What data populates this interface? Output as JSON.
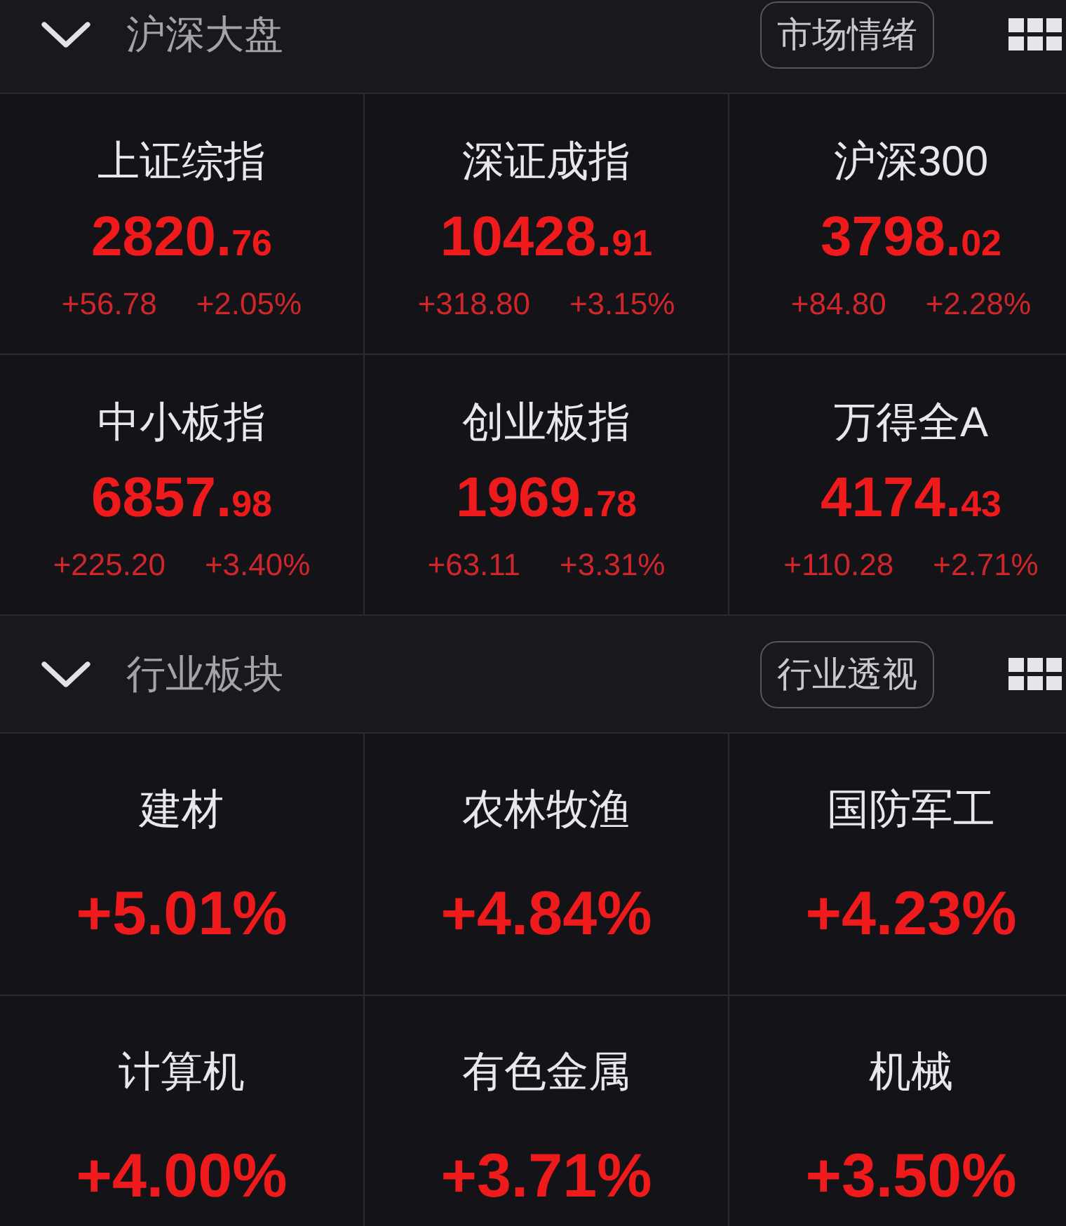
{
  "sections": [
    {
      "kind": "index",
      "title": "沪深大盘",
      "expanded": true,
      "button": "市场情绪",
      "items": [
        {
          "name": "上证综指",
          "value": "2820.76",
          "change": "+56.78",
          "change_pct": "+2.05%",
          "rising": true
        },
        {
          "name": "深证成指",
          "value": "10428.91",
          "change": "+318.80",
          "change_pct": "+3.15%",
          "rising": true
        },
        {
          "name": "沪深300",
          "value": "3798.02",
          "change": "+84.80",
          "change_pct": "+2.28%",
          "rising": true
        },
        {
          "name": "中小板指",
          "value": "6857.98",
          "change": "+225.20",
          "change_pct": "+3.40%",
          "rising": true
        },
        {
          "name": "创业板指",
          "value": "1969.78",
          "change": "+63.11",
          "change_pct": "+3.31%",
          "rising": true
        },
        {
          "name": "万得全A",
          "value": "4174.43",
          "change": "+110.28",
          "change_pct": "+2.71%",
          "rising": true
        }
      ]
    },
    {
      "kind": "sector",
      "title": "行业板块",
      "expanded": true,
      "button": "行业透视",
      "items": [
        {
          "name": "建材",
          "change_pct": "+5.01%",
          "rising": true
        },
        {
          "name": "农林牧渔",
          "change_pct": "+4.84%",
          "rising": true
        },
        {
          "name": "国防军工",
          "change_pct": "+4.23%",
          "rising": true
        },
        {
          "name": "计算机",
          "change_pct": "+4.00%",
          "rising": true
        },
        {
          "name": "有色金属",
          "change_pct": "+3.71%",
          "rising": true
        },
        {
          "name": "机械",
          "change_pct": "+3.50%",
          "rising": true
        }
      ]
    }
  ]
}
